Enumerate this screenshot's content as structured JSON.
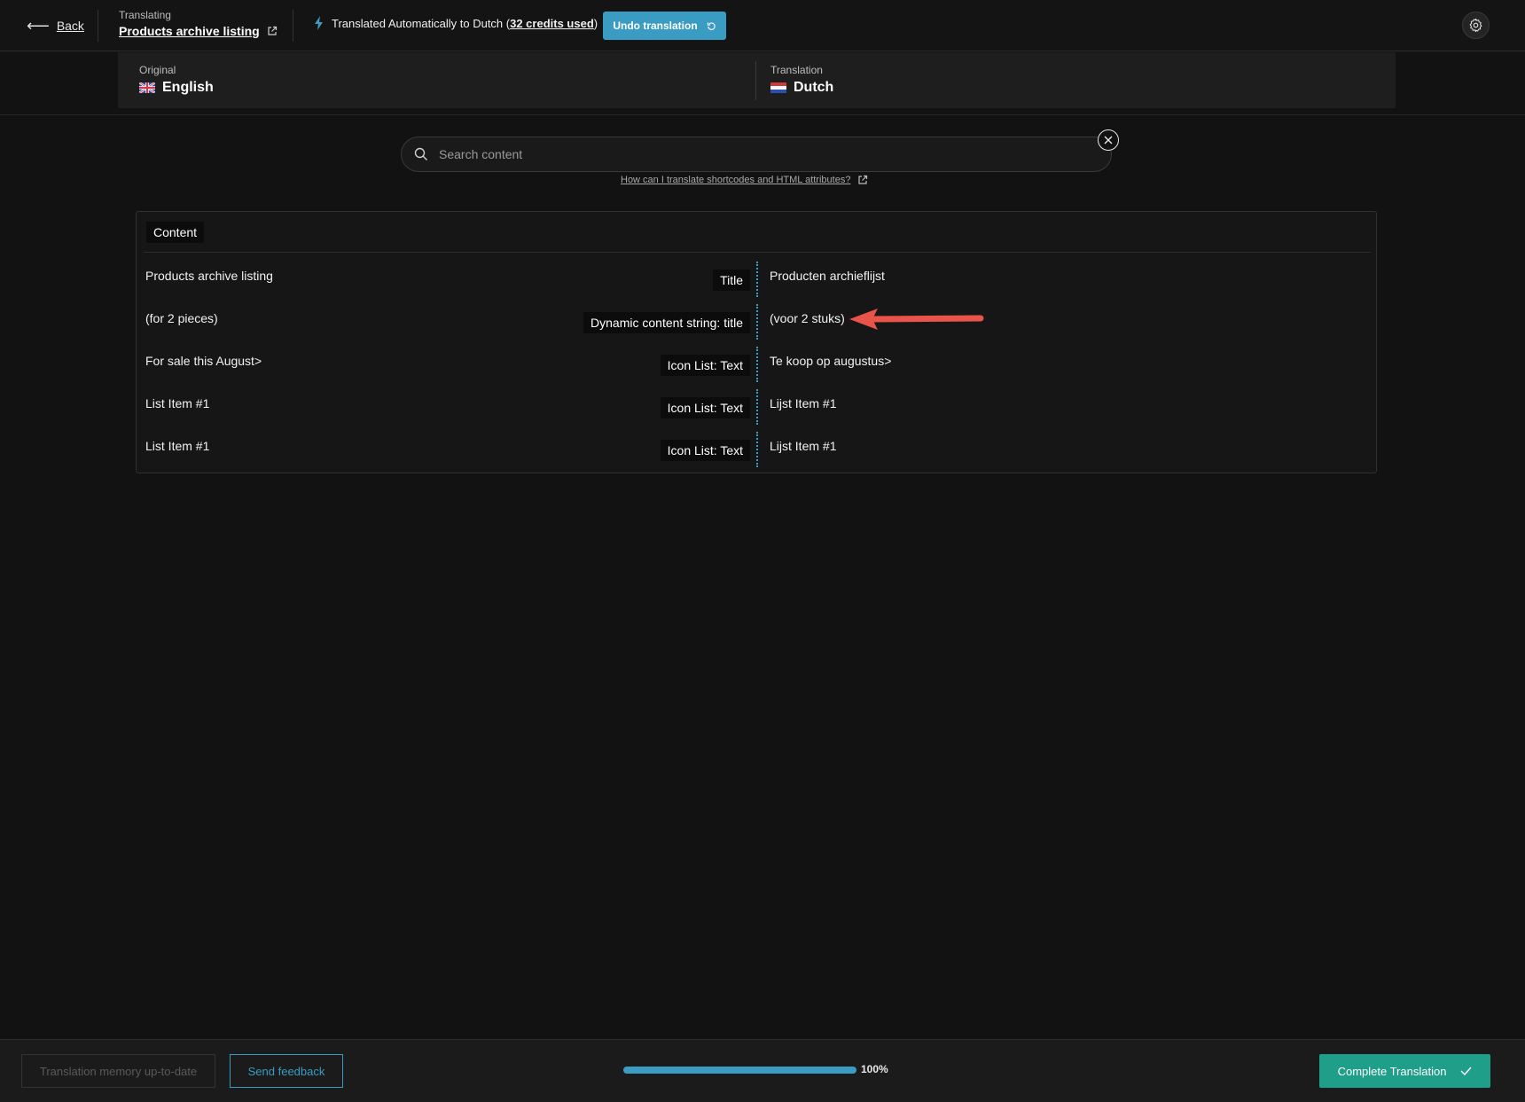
{
  "topbar": {
    "back_label": "Back",
    "translating_label": "Translating",
    "document_title": "Products archive listing",
    "auto_text": "Translated Automatically to Dutch (",
    "credits_text": "32 credits used",
    "auto_close": ")",
    "undo_label": "Undo translation"
  },
  "languages": {
    "original_label": "Original",
    "original_lang": "English",
    "translation_label": "Translation",
    "translation_lang": "Dutch"
  },
  "search": {
    "placeholder": "Search content",
    "help_link": "How can I translate shortcodes and HTML attributes?"
  },
  "content": {
    "tab_label": "Content",
    "rows": [
      {
        "original": "Products archive listing",
        "tag": "Title",
        "translation": "Producten archieflijst"
      },
      {
        "original": "(for 2 pieces)",
        "tag": "Dynamic content string: title",
        "translation": "(voor 2 stuks)"
      },
      {
        "original": "For sale this August>",
        "tag": "Icon List: Text",
        "translation": "Te koop op augustus>"
      },
      {
        "original": "List Item #1",
        "tag": "Icon List: Text",
        "translation": "Lijst Item #1"
      },
      {
        "original": "List Item #1",
        "tag": "Icon List: Text",
        "translation": "Lijst Item #1"
      }
    ]
  },
  "footer": {
    "memory_label": "Translation memory up-to-date",
    "feedback_label": "Send feedback",
    "progress": 100,
    "progress_label": "100%",
    "complete_label": "Complete Translation"
  },
  "colors": {
    "accent": "#3a9cc3",
    "complete": "#1f9e8a",
    "annotation_arrow": "#e8534a"
  },
  "icons": {
    "back": "arrow-left-icon",
    "external": "external-link-icon",
    "bolt": "lightning-icon",
    "undo": "undo-icon",
    "settings": "gear-icon",
    "search": "search-icon",
    "clear": "close-circle-icon",
    "check": "check-icon"
  }
}
